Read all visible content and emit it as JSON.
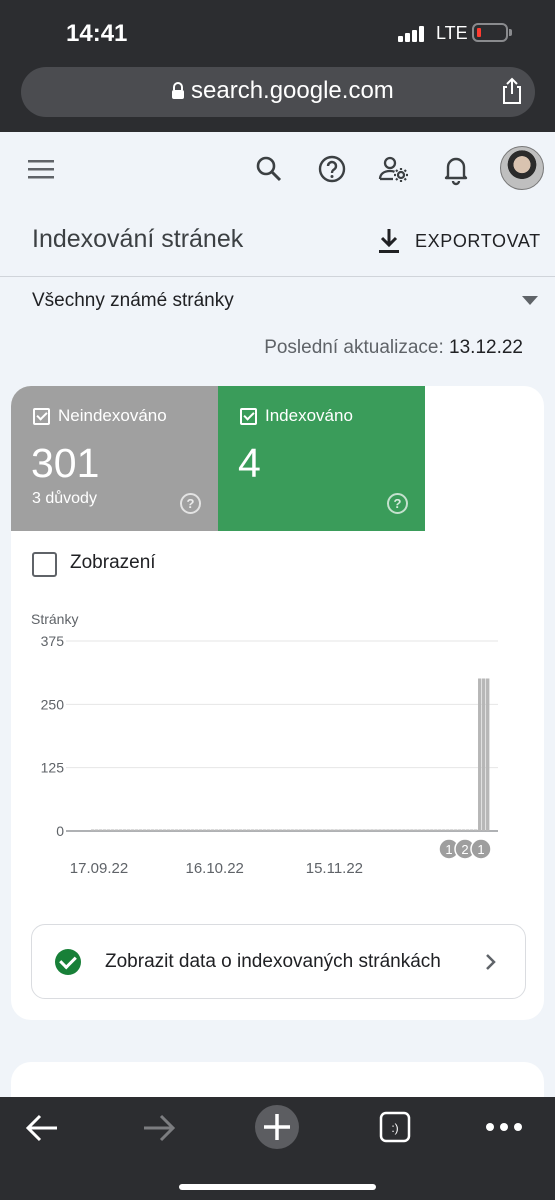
{
  "status_bar": {
    "time": "14:41",
    "network": "LTE"
  },
  "browser": {
    "url": "search.google.com",
    "icons": {
      "lock": "lock-icon",
      "share": "share-icon"
    }
  },
  "header": {
    "icons": [
      "menu-icon",
      "search-icon",
      "help-icon",
      "manage-users-icon",
      "notifications-icon",
      "account-avatar"
    ]
  },
  "page": {
    "title": "Indexování stránek",
    "export_label": "EXPORTOVAT",
    "filter_label": "Všechny známé stránky",
    "last_update_label": "Poslední aktualizace:",
    "last_update_value": "13.12.22"
  },
  "summary": {
    "not_indexed": {
      "label": "Neindexováno",
      "count": "301",
      "sub": "3 důvody",
      "help": "?",
      "color": "#a0a0a0"
    },
    "indexed": {
      "label": "Indexováno",
      "count": "4",
      "help": "?",
      "color": "#3a9c5a"
    }
  },
  "view_toggle": {
    "label": "Zobrazení",
    "checked": false
  },
  "chart_data": {
    "type": "bar",
    "ylabel": "Stránky",
    "ylim": [
      0,
      375
    ],
    "y_ticks": [
      "375",
      "250",
      "125",
      "0"
    ],
    "x_tick_labels": [
      "17.09.22",
      "16.10.22",
      "15.11.22"
    ],
    "x_start": "2022-09-15",
    "series": [
      {
        "name": "Neindexováno",
        "color": "#b7b7b7",
        "daily_value_before_spike": 3,
        "spike_values": [
          301,
          301,
          301
        ]
      }
    ],
    "annotations": [
      "1",
      "2",
      "1"
    ]
  },
  "link": {
    "text": "Zobrazit data o indexovaných stránkách"
  },
  "toolbar": {
    "tabs_label": ":)",
    "icons": [
      "back-icon",
      "forward-icon",
      "new-tab-icon",
      "tabs-icon",
      "more-icon"
    ]
  }
}
